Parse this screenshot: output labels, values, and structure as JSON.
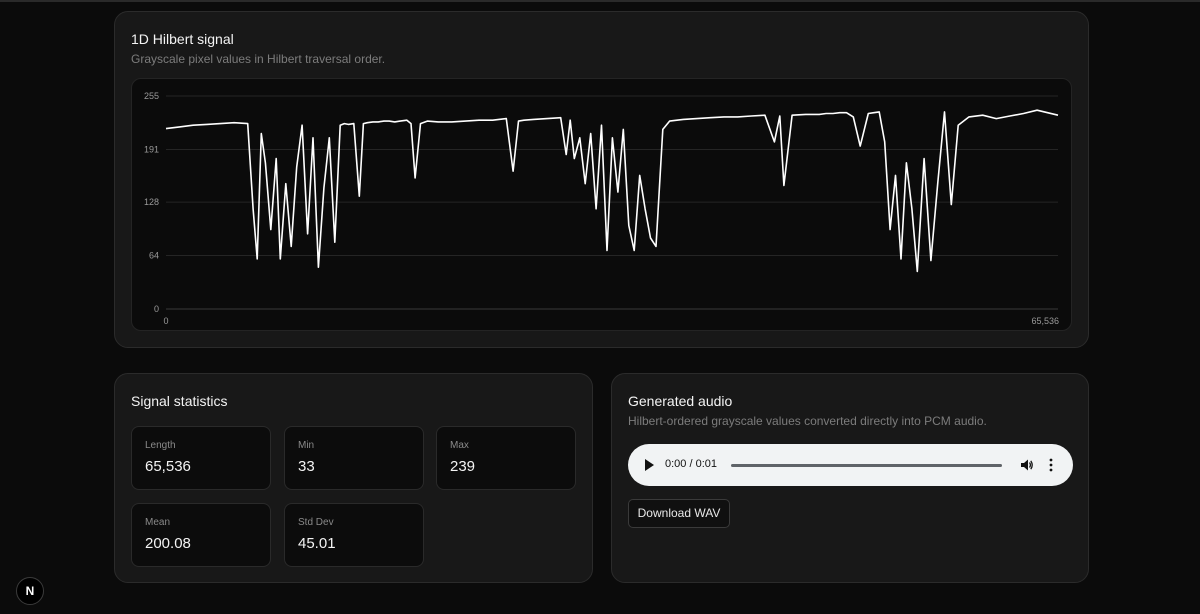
{
  "signal_card": {
    "title": "1D Hilbert signal",
    "subtitle": "Grayscale pixel values in Hilbert traversal order."
  },
  "chart_data": {
    "type": "line",
    "title": "",
    "xlabel": "",
    "ylabel": "",
    "xlim": [
      0,
      65536
    ],
    "ylim": [
      0,
      255
    ],
    "y_ticks": [
      "0",
      "64",
      "128",
      "191",
      "255"
    ],
    "x_ticks": [
      "0",
      "65,536"
    ],
    "grid": true,
    "line_color": "#ffffff",
    "series": [
      {
        "x": [
          0,
          1000,
          2000,
          3000,
          4000,
          5000,
          6000,
          6400,
          6700,
          7000,
          7300,
          7700,
          8100,
          8400,
          8800,
          9200,
          9600,
          10000,
          10400,
          10800,
          11200,
          11600,
          12000,
          12400,
          12800,
          13100,
          13400,
          13800,
          14200,
          14500,
          14800,
          15200,
          15600,
          16000,
          16400,
          16800,
          17200,
          17700,
          18000,
          18300,
          18700,
          19200,
          20000,
          21000,
          22000,
          23000,
          24000,
          25000,
          25500,
          25900,
          26300,
          27000,
          28000,
          29000,
          29400,
          29700,
          30000,
          30400,
          30800,
          31200,
          31600,
          32000,
          32400,
          32800,
          33200,
          33600,
          34000,
          34400,
          34800,
          35200,
          35600,
          36000,
          36500,
          37000,
          38000,
          39000,
          40000,
          41000,
          42000,
          43000,
          44000,
          44700,
          45100,
          45400,
          46000,
          47000,
          48000,
          48500,
          49000,
          49500,
          50000,
          50500,
          51000,
          51600,
          52000,
          52400,
          52800,
          53200,
          53600,
          54000,
          54400,
          54800,
          55200,
          55700,
          56200,
          56700,
          57200,
          57700,
          58200,
          59000,
          60000,
          61000,
          62000,
          63000,
          64000,
          65536
        ],
        "y": [
          216,
          218,
          220,
          221,
          222,
          223,
          222,
          120,
          60,
          210,
          175,
          95,
          180,
          60,
          150,
          75,
          170,
          220,
          90,
          205,
          50,
          145,
          205,
          80,
          220,
          222,
          221,
          222,
          135,
          222,
          223,
          224,
          224,
          225,
          225,
          224,
          225,
          226,
          222,
          157,
          222,
          225,
          224,
          224,
          225,
          226,
          226,
          228,
          165,
          225,
          226,
          227,
          228,
          229,
          185,
          226,
          180,
          205,
          150,
          210,
          120,
          220,
          70,
          205,
          140,
          215,
          100,
          70,
          160,
          120,
          85,
          75,
          215,
          225,
          227,
          228,
          229,
          230,
          230,
          231,
          232,
          200,
          231,
          148,
          232,
          233,
          233,
          234,
          234,
          235,
          235,
          230,
          195,
          234,
          235,
          236,
          200,
          95,
          160,
          60,
          175,
          120,
          45,
          180,
          58,
          150,
          236,
          125,
          220,
          230,
          232,
          228,
          231,
          234,
          238,
          232
        ]
      }
    ]
  },
  "stats_card": {
    "title": "Signal statistics",
    "items": [
      {
        "label": "Length",
        "value": "65,536"
      },
      {
        "label": "Min",
        "value": "33"
      },
      {
        "label": "Max",
        "value": "239"
      },
      {
        "label": "Mean",
        "value": "200.08"
      },
      {
        "label": "Std Dev",
        "value": "45.01"
      }
    ]
  },
  "audio_card": {
    "title": "Generated audio",
    "subtitle": "Hilbert-ordered grayscale values converted directly into PCM audio.",
    "player": {
      "time": "0:00 / 0:01",
      "progress": 0,
      "icons": [
        "play-icon",
        "volume-icon",
        "more-vertical-icon"
      ]
    },
    "download_label": "Download WAV"
  },
  "badge": {
    "label": "N"
  }
}
